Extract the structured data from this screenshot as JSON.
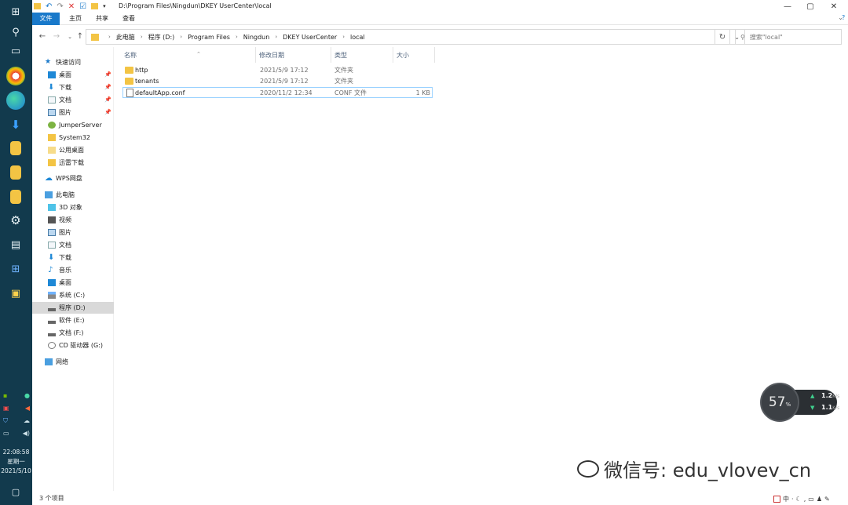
{
  "window": {
    "title_path": "D:\\Program Files\\Ningdun\\DKEY UserCenter\\local",
    "controls": {
      "minimize": "—",
      "maximize": "▢",
      "close": "✕"
    }
  },
  "ribbon": {
    "tabs": [
      "文件",
      "主页",
      "共享",
      "查看"
    ]
  },
  "address": {
    "crumbs": [
      "此电脑",
      "程序 (D:)",
      "Program Files",
      "Ningdun",
      "DKEY UserCenter",
      "local"
    ],
    "search_placeholder": "搜索\"local\""
  },
  "navpane": {
    "quick_access": "快速访问",
    "pinned": [
      "桌面",
      "下载",
      "文档",
      "图片"
    ],
    "recent": [
      "JumperServer",
      "System32",
      "公用桌面",
      "迅雷下载"
    ],
    "wps": "WPS网盘",
    "this_pc": "此电脑",
    "pc_items": [
      "3D 对象",
      "视频",
      "图片",
      "文档",
      "下载",
      "音乐",
      "桌面",
      "系统 (C:)",
      "程序 (D:)",
      "软件 (E:)",
      "文档 (F:)",
      "CD 驱动器 (G:)"
    ],
    "network": "网络",
    "selected": "程序 (D:)"
  },
  "filelist": {
    "columns": {
      "name": "名称",
      "modified": "修改日期",
      "type": "类型",
      "size": "大小"
    },
    "rows": [
      {
        "name": "http",
        "modified": "2021/5/9 17:12",
        "type": "文件夹",
        "size": "",
        "kind": "folder"
      },
      {
        "name": "tenants",
        "modified": "2021/5/9 17:12",
        "type": "文件夹",
        "size": "",
        "kind": "folder"
      },
      {
        "name": "defaultApp.conf",
        "modified": "2020/11/2 12:34",
        "type": "CONF 文件",
        "size": "1 KB",
        "kind": "file"
      }
    ]
  },
  "status": {
    "item_count": "3 个项目"
  },
  "taskbar": {
    "time": "22:08:58",
    "weekday": "星期一",
    "date": "2021/5/10"
  },
  "speed_widget": {
    "percent": "57",
    "percent_unit": "%",
    "up": "1.2",
    "down": "1.1",
    "unit": "K/s"
  },
  "ime": {
    "mode": "中"
  },
  "watermark": {
    "text": "微信号: edu_vlovev_cn"
  },
  "colors": {
    "accent": "#1979ca",
    "taskbar": "#123a4d",
    "folder": "#f3c444"
  }
}
